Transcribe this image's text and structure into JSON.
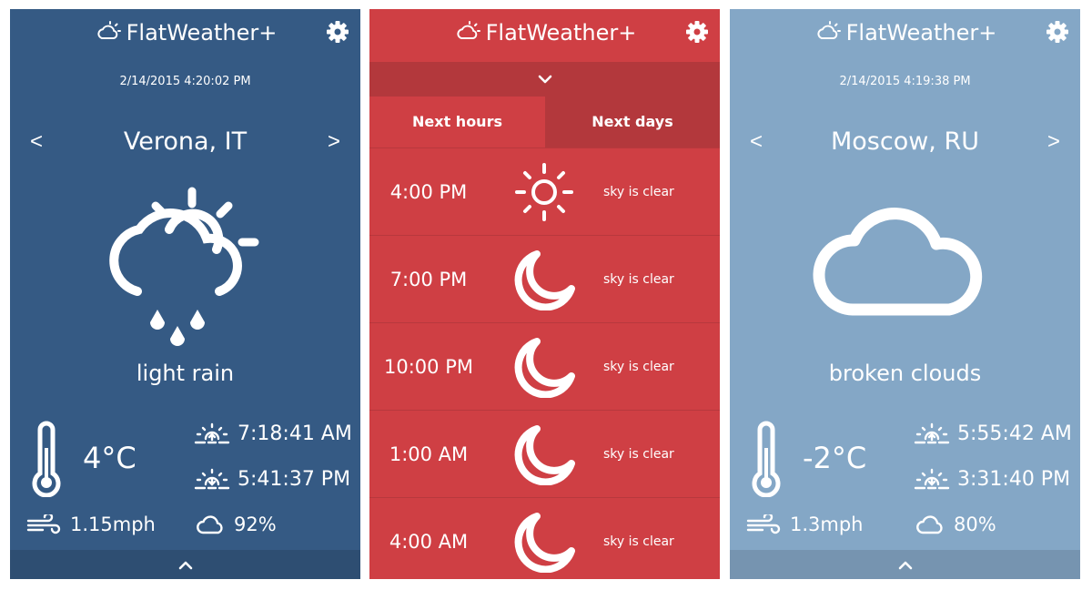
{
  "app": {
    "title": "FlatWeather+"
  },
  "colors": {
    "panel1": "#355a84",
    "panel2": "#cf3f44",
    "panel3": "#84a7c6"
  },
  "panel1": {
    "datetime": "2/14/2015 4:20:02 PM",
    "prev_label": "<",
    "next_label": ">",
    "city": "Verona, IT",
    "main_icon": "rain-partly-sunny-icon",
    "condition": "light rain",
    "temperature": "4°C",
    "sunrise": "7:18:41 AM",
    "sunset": "5:41:37 PM",
    "wind": "1.15mph",
    "clouds": "92%"
  },
  "panel2": {
    "tabs": [
      {
        "label": "Next hours",
        "active": true
      },
      {
        "label": "Next days",
        "active": false
      }
    ],
    "hours": [
      {
        "time": "4:00 PM",
        "icon": "sun-icon",
        "desc": "sky is clear"
      },
      {
        "time": "7:00 PM",
        "icon": "moon-icon",
        "desc": "sky is clear"
      },
      {
        "time": "10:00 PM",
        "icon": "moon-icon",
        "desc": "sky is clear"
      },
      {
        "time": "1:00 AM",
        "icon": "moon-icon",
        "desc": "sky is clear"
      },
      {
        "time": "4:00 AM",
        "icon": "moon-icon",
        "desc": "sky is clear"
      }
    ]
  },
  "panel3": {
    "datetime": "2/14/2015 4:19:38 PM",
    "prev_label": "<",
    "next_label": ">",
    "city": "Moscow, RU",
    "main_icon": "cloud-icon",
    "condition": "broken clouds",
    "temperature": "-2°C",
    "sunrise": "5:55:42 AM",
    "sunset": "3:31:40 PM",
    "wind": "1.3mph",
    "clouds": "80%"
  }
}
